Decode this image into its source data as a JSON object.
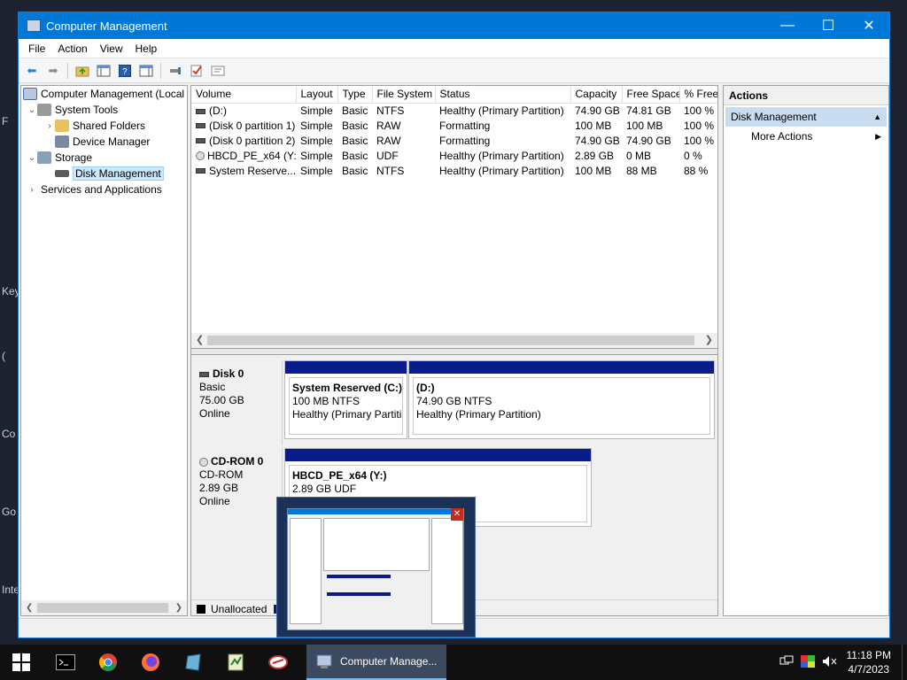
{
  "desktop": {
    "fragments": [
      "F",
      "Key",
      "(",
      "Co",
      "Go",
      "Inte"
    ]
  },
  "window": {
    "title": "Computer Management",
    "minimize_glyph": "—",
    "maximize_glyph": "☐",
    "close_glyph": "✕"
  },
  "menu": {
    "file": "File",
    "action": "Action",
    "view": "View",
    "help": "Help"
  },
  "toolbar": {
    "back_icon": "arrow-left-icon",
    "forward_icon": "arrow-right-icon",
    "back_glyph": "⬅",
    "forward_glyph": "➡"
  },
  "tree": {
    "root": "Computer Management (Local",
    "system_tools": "System Tools",
    "shared_folders": "Shared Folders",
    "device_manager": "Device Manager",
    "storage": "Storage",
    "disk_management": "Disk Management",
    "services": "Services and Applications"
  },
  "volumes": {
    "headers": {
      "volume": "Volume",
      "layout": "Layout",
      "type": "Type",
      "fs": "File System",
      "status": "Status",
      "capacity": "Capacity",
      "free": "Free Space",
      "pct": "% Free"
    },
    "rows": [
      {
        "volume": "(D:)",
        "layout": "Simple",
        "type": "Basic",
        "fs": "NTFS",
        "status": "Healthy (Primary Partition)",
        "capacity": "74.90 GB",
        "free": "74.81 GB",
        "pct": "100 %"
      },
      {
        "volume": "(Disk 0 partition 1)",
        "layout": "Simple",
        "type": "Basic",
        "fs": "RAW",
        "status": "Formatting",
        "capacity": "100 MB",
        "free": "100 MB",
        "pct": "100 %"
      },
      {
        "volume": "(Disk 0 partition 2)",
        "layout": "Simple",
        "type": "Basic",
        "fs": "RAW",
        "status": "Formatting",
        "capacity": "74.90 GB",
        "free": "74.90 GB",
        "pct": "100 %"
      },
      {
        "volume": "HBCD_PE_x64 (Y:)",
        "layout": "Simple",
        "type": "Basic",
        "fs": "UDF",
        "status": "Healthy (Primary Partition)",
        "capacity": "2.89 GB",
        "free": "0 MB",
        "pct": "0 %"
      },
      {
        "volume": "System Reserve...",
        "layout": "Simple",
        "type": "Basic",
        "fs": "NTFS",
        "status": "Healthy (Primary Partition)",
        "capacity": "100 MB",
        "free": "88 MB",
        "pct": "88 %"
      }
    ]
  },
  "disks": {
    "disk0": {
      "name": "Disk 0",
      "type": "Basic",
      "size": "75.00 GB",
      "state": "Online",
      "p1": {
        "name": "System Reserved  (C:)",
        "size": "100 MB NTFS",
        "status": "Healthy (Primary Partiti"
      },
      "p2": {
        "name": "(D:)",
        "size": "74.90 GB NTFS",
        "status": "Healthy (Primary Partition)"
      }
    },
    "cdrom0": {
      "name": "CD-ROM 0",
      "type": "CD-ROM",
      "size": "2.89 GB",
      "state": "Online",
      "p1": {
        "name": "HBCD_PE_x64  (Y:)",
        "size": "2.89 GB UDF"
      }
    }
  },
  "legend": {
    "unallocated": "Unallocated"
  },
  "actions": {
    "header": "Actions",
    "section": "Disk Management",
    "more": "More Actions"
  },
  "taskbar": {
    "active_label": "Computer Manage...",
    "time": "11:18 PM",
    "date": "4/7/2023"
  },
  "colors": {
    "titlebar": "#0078d7",
    "partition_bar": "#0a1b8a",
    "selection": "#cce8ff",
    "taskbar": "#101010"
  }
}
